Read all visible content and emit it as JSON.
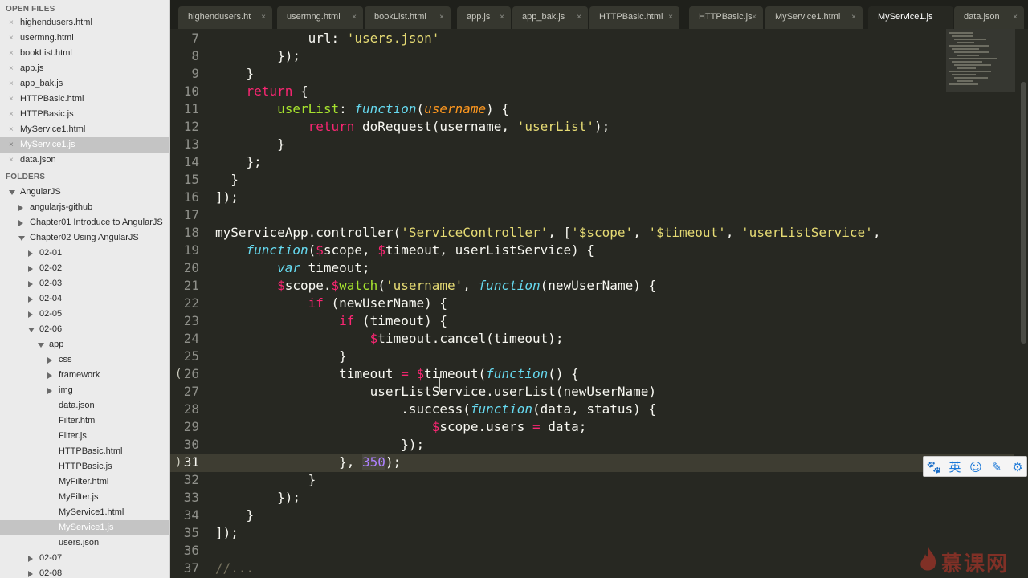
{
  "sidebar": {
    "open_files_heading": "OPEN FILES",
    "folders_heading": "FOLDERS",
    "open_files": [
      {
        "label": "highendusers.html"
      },
      {
        "label": "usermng.html"
      },
      {
        "label": "bookList.html"
      },
      {
        "label": "app.js"
      },
      {
        "label": "app_bak.js"
      },
      {
        "label": "HTTPBasic.html"
      },
      {
        "label": "HTTPBasic.js"
      },
      {
        "label": "MyService1.html"
      },
      {
        "label": "MyService1.js"
      },
      {
        "label": "data.json"
      }
    ],
    "active_open_file": "MyService1.js",
    "tree": [
      {
        "label": "AngularJS"
      },
      {
        "label": "angularjs-github"
      },
      {
        "label": "Chapter01 Introduce to AngularJS"
      },
      {
        "label": "Chapter02 Using AngularJS"
      },
      {
        "label": "02-01"
      },
      {
        "label": "02-02"
      },
      {
        "label": "02-03"
      },
      {
        "label": "02-04"
      },
      {
        "label": "02-05"
      },
      {
        "label": "02-06"
      },
      {
        "label": "app"
      },
      {
        "label": "css"
      },
      {
        "label": "framework"
      },
      {
        "label": "img"
      },
      {
        "label": "data.json"
      },
      {
        "label": "Filter.html"
      },
      {
        "label": "Filter.js"
      },
      {
        "label": "HTTPBasic.html"
      },
      {
        "label": "HTTPBasic.js"
      },
      {
        "label": "MyFilter.html"
      },
      {
        "label": "MyFilter.js"
      },
      {
        "label": "MyService1.html"
      },
      {
        "label": "MyService1.js"
      },
      {
        "label": "users.json"
      },
      {
        "label": "02-07"
      },
      {
        "label": "02-08"
      }
    ]
  },
  "tabs": [
    {
      "label": "highendusers.ht"
    },
    {
      "label": "usermng.html"
    },
    {
      "label": "bookList.html"
    },
    {
      "label": "app.js"
    },
    {
      "label": "app_bak.js"
    },
    {
      "label": "HTTPBasic.html"
    },
    {
      "label": "HTTPBasic.js"
    },
    {
      "label": "MyService1.html"
    },
    {
      "label": "MyService1.js"
    },
    {
      "label": "data.json"
    }
  ],
  "tab_close_glyph": "×",
  "active_tab": "MyService1.js",
  "editor": {
    "current_line": "31",
    "lines": [
      {
        "n": "7",
        "tokens": [
          {
            "t": "            url: "
          },
          {
            "t": "'users.json'",
            "c": "str"
          }
        ]
      },
      {
        "n": "8",
        "tokens": [
          {
            "t": "        });"
          }
        ]
      },
      {
        "n": "9",
        "tokens": [
          {
            "t": "    }"
          }
        ]
      },
      {
        "n": "10",
        "tokens": [
          {
            "t": "    "
          },
          {
            "t": "return",
            "c": "kw"
          },
          {
            "t": " {"
          }
        ]
      },
      {
        "n": "11",
        "tokens": [
          {
            "t": "        "
          },
          {
            "t": "userList",
            "c": "prop"
          },
          {
            "t": ": "
          },
          {
            "t": "function",
            "c": "fn"
          },
          {
            "t": "("
          },
          {
            "t": "username",
            "c": "param"
          },
          {
            "t": ") {"
          }
        ]
      },
      {
        "n": "12",
        "tokens": [
          {
            "t": "            "
          },
          {
            "t": "return",
            "c": "kw"
          },
          {
            "t": " doRequest(username, "
          },
          {
            "t": "'userList'",
            "c": "str"
          },
          {
            "t": ");"
          }
        ]
      },
      {
        "n": "13",
        "tokens": [
          {
            "t": "        }"
          }
        ]
      },
      {
        "n": "14",
        "tokens": [
          {
            "t": "    };"
          }
        ]
      },
      {
        "n": "15",
        "tokens": [
          {
            "t": "  }"
          }
        ]
      },
      {
        "n": "16",
        "tokens": [
          {
            "t": "]);"
          }
        ]
      },
      {
        "n": "17",
        "tokens": [
          {
            "t": ""
          }
        ]
      },
      {
        "n": "18",
        "tokens": [
          {
            "t": "myServiceApp.controller("
          },
          {
            "t": "'ServiceController'",
            "c": "str"
          },
          {
            "t": ", ["
          },
          {
            "t": "'$scope'",
            "c": "str"
          },
          {
            "t": ", "
          },
          {
            "t": "'$timeout'",
            "c": "str"
          },
          {
            "t": ", "
          },
          {
            "t": "'userListService'",
            "c": "str"
          },
          {
            "t": ","
          }
        ]
      },
      {
        "n": "19",
        "tokens": [
          {
            "t": "    "
          },
          {
            "t": "function",
            "c": "fn"
          },
          {
            "t": "("
          },
          {
            "t": "$",
            "c": "kw"
          },
          {
            "t": "scope, "
          },
          {
            "t": "$",
            "c": "kw"
          },
          {
            "t": "timeout, userListService) {"
          }
        ]
      },
      {
        "n": "20",
        "tokens": [
          {
            "t": "        "
          },
          {
            "t": "var",
            "c": "fn"
          },
          {
            "t": " timeout;"
          }
        ]
      },
      {
        "n": "21",
        "tokens": [
          {
            "t": "        "
          },
          {
            "t": "$",
            "c": "kw"
          },
          {
            "t": "scope."
          },
          {
            "t": "$",
            "c": "kw"
          },
          {
            "t": "watch",
            "c": "prop"
          },
          {
            "t": "("
          },
          {
            "t": "'username'",
            "c": "str"
          },
          {
            "t": ", "
          },
          {
            "t": "function",
            "c": "fn"
          },
          {
            "t": "(newUserName) {"
          }
        ]
      },
      {
        "n": "22",
        "tokens": [
          {
            "t": "            "
          },
          {
            "t": "if",
            "c": "kw"
          },
          {
            "t": " (newUserName) {"
          }
        ]
      },
      {
        "n": "23",
        "tokens": [
          {
            "t": "                "
          },
          {
            "t": "if",
            "c": "kw"
          },
          {
            "t": " (timeout) {"
          }
        ]
      },
      {
        "n": "24",
        "tokens": [
          {
            "t": "                    "
          },
          {
            "t": "$",
            "c": "kw"
          },
          {
            "t": "timeout.cancel(timeout);"
          }
        ]
      },
      {
        "n": "25",
        "tokens": [
          {
            "t": "                }"
          }
        ]
      },
      {
        "n": "26",
        "tokens": [
          {
            "t": "                timeout "
          },
          {
            "t": "=",
            "c": "kw"
          },
          {
            "t": " "
          },
          {
            "t": "$",
            "c": "kw"
          },
          {
            "t": "timeout("
          },
          {
            "t": "function",
            "c": "fn"
          },
          {
            "t": "() {"
          }
        ]
      },
      {
        "n": "27",
        "tokens": [
          {
            "t": "                    userListService.userList(newUserName)"
          }
        ]
      },
      {
        "n": "28",
        "tokens": [
          {
            "t": "                        .success("
          },
          {
            "t": "function",
            "c": "fn"
          },
          {
            "t": "(data, status) {"
          }
        ]
      },
      {
        "n": "29",
        "tokens": [
          {
            "t": "                            "
          },
          {
            "t": "$",
            "c": "kw"
          },
          {
            "t": "scope.users "
          },
          {
            "t": "=",
            "c": "kw"
          },
          {
            "t": " data;"
          }
        ]
      },
      {
        "n": "30",
        "tokens": [
          {
            "t": "                        });"
          }
        ]
      },
      {
        "n": "31",
        "tokens": [
          {
            "t": "                }, "
          },
          {
            "t": "350",
            "c": "num"
          },
          {
            "t": ");"
          }
        ]
      },
      {
        "n": "32",
        "tokens": [
          {
            "t": "            }"
          }
        ]
      },
      {
        "n": "33",
        "tokens": [
          {
            "t": "        });"
          }
        ]
      },
      {
        "n": "34",
        "tokens": [
          {
            "t": "    }"
          }
        ]
      },
      {
        "n": "35",
        "tokens": [
          {
            "t": "]);"
          }
        ]
      },
      {
        "n": "36",
        "tokens": [
          {
            "t": ""
          }
        ]
      },
      {
        "n": "37",
        "tokens": [
          {
            "t": "//...",
            "c": "cmt"
          }
        ]
      }
    ],
    "fold_markers": [
      {
        "line": "26",
        "glyph": "("
      },
      {
        "line": "31",
        "glyph": ")"
      }
    ]
  },
  "ime_toolbar": {
    "buttons": [
      {
        "name": "paw-icon",
        "glyph": "🐾"
      },
      {
        "name": "lang-toggle",
        "glyph": "英"
      },
      {
        "name": "emoji-icon",
        "glyph": "☺"
      },
      {
        "name": "pen-icon",
        "glyph": "✎"
      },
      {
        "name": "settings-gear-icon",
        "glyph": "⚙"
      }
    ]
  },
  "watermark": {
    "text": "慕课网"
  },
  "colors": {
    "editor_bg": "#272822",
    "keyword": "#f92672",
    "string": "#e6db74",
    "function": "#66d9ef",
    "property": "#a6e22e",
    "param": "#fd971f",
    "number": "#ae81ff",
    "comment": "#75715e"
  }
}
